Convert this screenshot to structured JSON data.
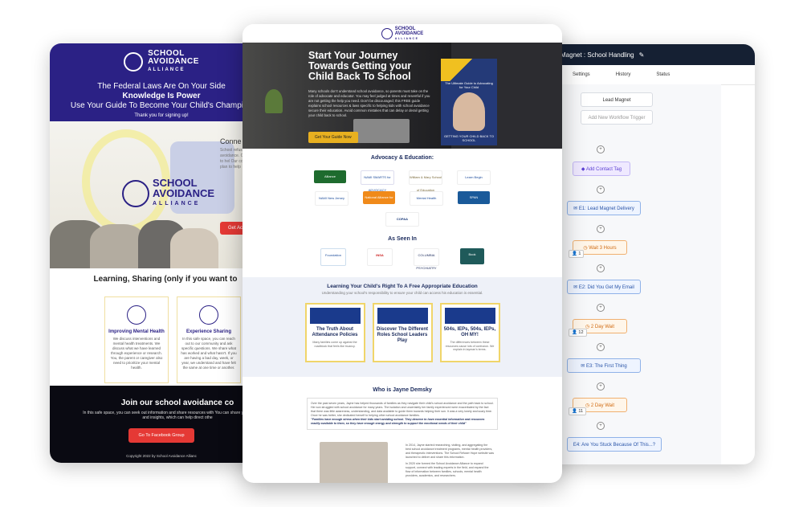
{
  "left": {
    "logo_line1": "SCHOOL",
    "logo_line2": "AVOIDANCE",
    "logo_line3": "ALLIANCE",
    "headline1": "The Federal Laws Are On Your Side",
    "headline2": "Knowledge Is Power",
    "headline3": "Use Your Guide To Become Your Child's Champion",
    "thanks": "Thank you for signing up!",
    "hero_logo1": "SCHOOL",
    "hero_logo2": "AVOIDANCE",
    "hero_logo3": "ALLIANCE",
    "hero_side_title": "Conne avoida",
    "hero_side_text": "School refusal supportive c avoidance. Our member want to hel Our comm their child's plan to help",
    "get_btn": "Get Ac",
    "learning_title": "Learning, Sharing (only if you want to",
    "features": [
      {
        "title": "Improving Mental Health",
        "desc": "We discuss interventions and mental health treatments. We discuss what we have learned through experience or research. You, the parent or caregiver also need to prioritize your mental health."
      },
      {
        "title": "Experience Sharing",
        "desc": "In this safe space, you can reach out to our community and ask specific questions. We share what has worked and what hasn't. If you are having a bad day, week, or year, we understand and have felt the same at one time or another."
      }
    ],
    "join_title": "Join our school avoidance co",
    "join_desc": "In this safe space, you can seek out information and share resources with You can share your experiences and insights, which can help direct othe",
    "fb_btn": "Go To Facebook Group",
    "copyright": "Copyright 2022 by School Avoidance Allianc"
  },
  "right": {
    "title": "Magnet : School Handling",
    "edit_icon": "pencil-icon",
    "tabs": [
      "Settings",
      "History",
      "Status"
    ],
    "nodes": [
      {
        "label": "Lead Magnet",
        "kind": "box"
      },
      {
        "label": "Add New Workflow Trigger",
        "kind": "trig"
      },
      {
        "label": "Add Contact Tag",
        "kind": "tag"
      },
      {
        "label": "E1: Lead Magnet Delivery",
        "kind": "email"
      },
      {
        "label": "Wait 3 Hours",
        "kind": "wait"
      },
      {
        "label": "E2: Did You Get My Email",
        "kind": "email"
      },
      {
        "label": "2 Day Wait",
        "kind": "wait"
      },
      {
        "label": "E3: The First Thing",
        "kind": "email"
      },
      {
        "label": "2 Day Wait",
        "kind": "wait"
      },
      {
        "label": "E4: Are You Stuck Because Of This...?",
        "kind": "email"
      }
    ],
    "counts": [
      "1",
      "12",
      "11"
    ]
  },
  "center": {
    "logo_line1": "SCHOOL",
    "logo_line2": "AVOIDANCE",
    "logo_line3": "ALLIANCE",
    "hero_title": "Start Your Journey Towards Getting your Child Back To School",
    "hero_text": "Many schools don't understand school avoidance, so parents must take on the role of advocate and educator. You may feel judged at times and resentful if you are not getting the help you need. Don't be discouraged; this FREE guide explains school resources & laws specific to helping kids with school avoidance secure their education. Avoid common mistakes that can delay or derail getting your child back to school.",
    "hero_btn": "Get Your Guide Now",
    "book_title": "The Ultimate Guide to Advocating for Your Child",
    "book_sub": "GETTING YOUR CHILD BACK TO SCHOOL",
    "advocacy_title": "Advocacy & Education:",
    "advocacy_logos": [
      "Alliance",
      "NAMI SMARTS for ADVOCACY",
      "William & Mary School of Education",
      "Learn Begin",
      "NAMI New Jersey",
      "National Alliance for Mental Wellbeing",
      "Mental Health",
      "SPAN",
      "COPAA"
    ],
    "asseen_title": "As Seen In",
    "asseen_logos": [
      "Foundation",
      "INSA",
      "COLUMBIA PSYCHIATRY",
      "Book"
    ],
    "learn_title": "Learning Your Child's Right To A Free Appropriate Education",
    "learn_sub": "Understanding your school's responsibility to ensure your child can access his education is essential.",
    "cards": [
      {
        "title": "The Truth About Attendance Policies",
        "desc": "Many families come up against the roadblock that feels like truancy."
      },
      {
        "title": "Discover The Different Roles School Leaders Play",
        "desc": ""
      },
      {
        "title": "504s, IEPs, 504s, IEPs, OH MY!",
        "desc": "The differences between these resources cause lots of confusion. We explain in layman's terms."
      }
    ],
    "who_title": "Who is Jayne Demsky",
    "who_text": "Over the past seven years, Jayne has helped thousands of families as they navigate their child's school avoidance and the path back to school. Her son struggled with school avoidance for many years. The isolation and uncertainty her family experienced were exacerbated by the fact that there was little awareness, understanding, and data available to guide them towards helping their son. It was a very lonely and scary time. Once he was better, she dedicated herself to helping other school avoidance families.",
    "who_quote": "\"Families have enough stress when their kids start avoiding school. They deserve to have essential information and resources readily available to them, so they have enough energy and strength to support the emotional needs of their child\"",
    "bio1": "In 2014, Jayne started researching, visiting, and aggregating the best school avoidance treatment programs, mental health providers, and therapeutic interventions. The School Refuser Hope website was launched to deliver and share this information.",
    "bio2": "In 2020 she formed the School Avoidance Alliance to expand support, connect with leading experts in the field, and expand the flow of information between families, schools, mental health providers, academics, and researchers."
  },
  "colors": {
    "brand_navy": "#2b2185",
    "accent_red": "#e53935",
    "accent_gold": "#e8b020"
  }
}
